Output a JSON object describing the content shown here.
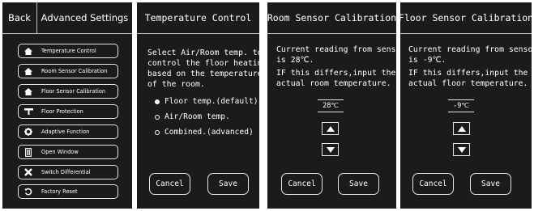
{
  "panel1": {
    "back_label": "Back",
    "title": "Advanced Settings",
    "menu": [
      {
        "label": "Temperature Control",
        "icon": "house-icon"
      },
      {
        "label": "Room Sensor Calibration",
        "icon": "house-icon"
      },
      {
        "label": "Floor Sensor Calibration",
        "icon": "house-icon"
      },
      {
        "label": "Floor Protection",
        "icon": "heater-icon"
      },
      {
        "label": "Adaptive Function",
        "icon": "gear-icon"
      },
      {
        "label": "Open Window",
        "icon": "window-icon"
      },
      {
        "label": "Switch Differential",
        "icon": "cross-icon"
      },
      {
        "label": "Factory Reset",
        "icon": "reset-icon"
      }
    ]
  },
  "panel2": {
    "title": "Temperature Control",
    "description": [
      "Select Air/Room temp. to",
      "control the floor heating",
      "based on the temperature",
      "of the room."
    ],
    "options": [
      {
        "label": "Floor temp.(default)",
        "selected": true
      },
      {
        "label": "Air/Room temp.",
        "selected": false
      },
      {
        "label": "Combined.(advanced)",
        "selected": false
      }
    ],
    "cancel": "Cancel",
    "save": "Save"
  },
  "panel3": {
    "title": "Room Sensor Calibration",
    "text": [
      "Current reading from sensor",
      "is 28℃.",
      "IF this differs,input the",
      "actual room temperature."
    ],
    "value": "28℃",
    "cancel": "Cancel",
    "save": "Save"
  },
  "panel4": {
    "title": "Floor Sensor Calibration",
    "text": [
      "Current reading from sensor",
      "is -9℃.",
      "IF this differs,input the",
      "actual floor temperature."
    ],
    "value": "-9℃",
    "cancel": "Cancel",
    "save": "Save"
  }
}
